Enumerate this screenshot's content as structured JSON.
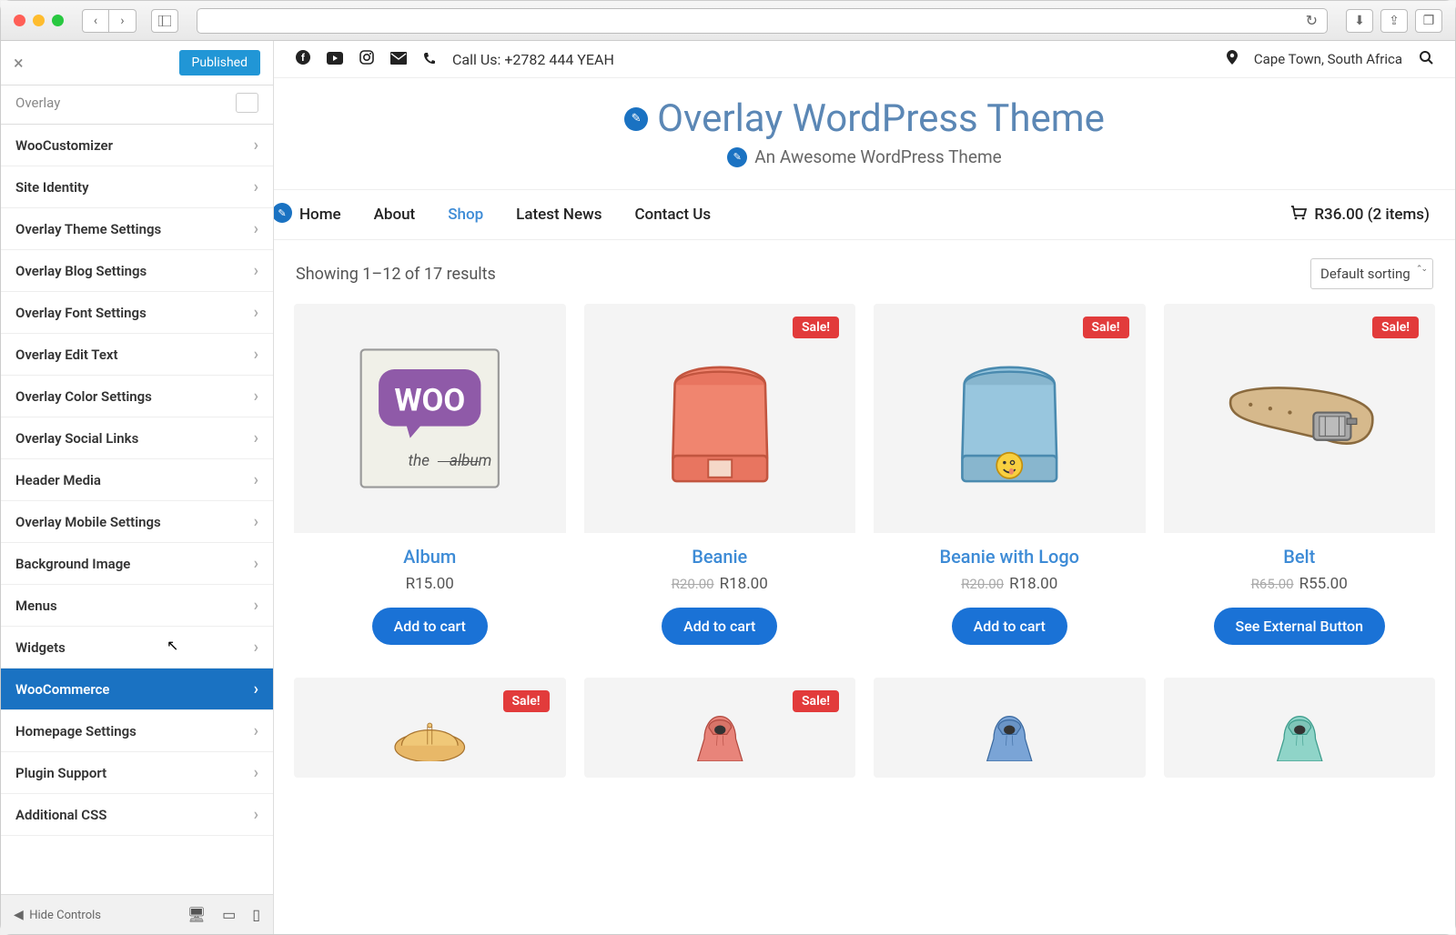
{
  "chrome": {
    "reload_icon": "↻",
    "download_icon": "⬇",
    "share_icon": "⇪",
    "tabs_icon": "❐"
  },
  "customizer": {
    "publish_label": "Published",
    "theme_name": "Overlay",
    "hide_controls": "Hide Controls",
    "items": [
      {
        "label": "WooCustomizer",
        "active": false
      },
      {
        "label": "Site Identity",
        "active": false
      },
      {
        "label": "Overlay Theme Settings",
        "active": false
      },
      {
        "label": "Overlay Blog Settings",
        "active": false
      },
      {
        "label": "Overlay Font Settings",
        "active": false
      },
      {
        "label": "Overlay Edit Text",
        "active": false
      },
      {
        "label": "Overlay Color Settings",
        "active": false
      },
      {
        "label": "Overlay Social Links",
        "active": false
      },
      {
        "label": "Header Media",
        "active": false
      },
      {
        "label": "Overlay Mobile Settings",
        "active": false
      },
      {
        "label": "Background Image",
        "active": false
      },
      {
        "label": "Menus",
        "active": false
      },
      {
        "label": "Widgets",
        "active": false
      },
      {
        "label": "WooCommerce",
        "active": true
      },
      {
        "label": "Homepage Settings",
        "active": false
      },
      {
        "label": "Plugin Support",
        "active": false
      },
      {
        "label": "Additional CSS",
        "active": false
      }
    ]
  },
  "topbar": {
    "call_text": "Call Us: +2782 444 YEAH",
    "location": "Cape Town, South Africa"
  },
  "hero": {
    "title": "Overlay WordPress Theme",
    "subtitle": "An Awesome WordPress Theme"
  },
  "nav": {
    "items": [
      "Home",
      "About",
      "Shop",
      "Latest News",
      "Contact Us"
    ],
    "active": "Shop",
    "cart_text": "R36.00 (2 items)"
  },
  "shop": {
    "result_text": "Showing 1–12 of 17 results",
    "sort": "Default sorting",
    "sale_label": "Sale!",
    "products": [
      {
        "title": "Album",
        "price": "R15.00",
        "button": "Add to cart"
      },
      {
        "title": "Beanie",
        "old": "R20.00",
        "price": "R18.00",
        "button": "Add to cart",
        "sale": true
      },
      {
        "title": "Beanie with Logo",
        "old": "R20.00",
        "price": "R18.00",
        "button": "Add to cart",
        "sale": true
      },
      {
        "title": "Belt",
        "old": "R65.00",
        "price": "R55.00",
        "button": "See External Button",
        "sale": true
      }
    ],
    "row2_sales": [
      true,
      true,
      false,
      false
    ]
  }
}
